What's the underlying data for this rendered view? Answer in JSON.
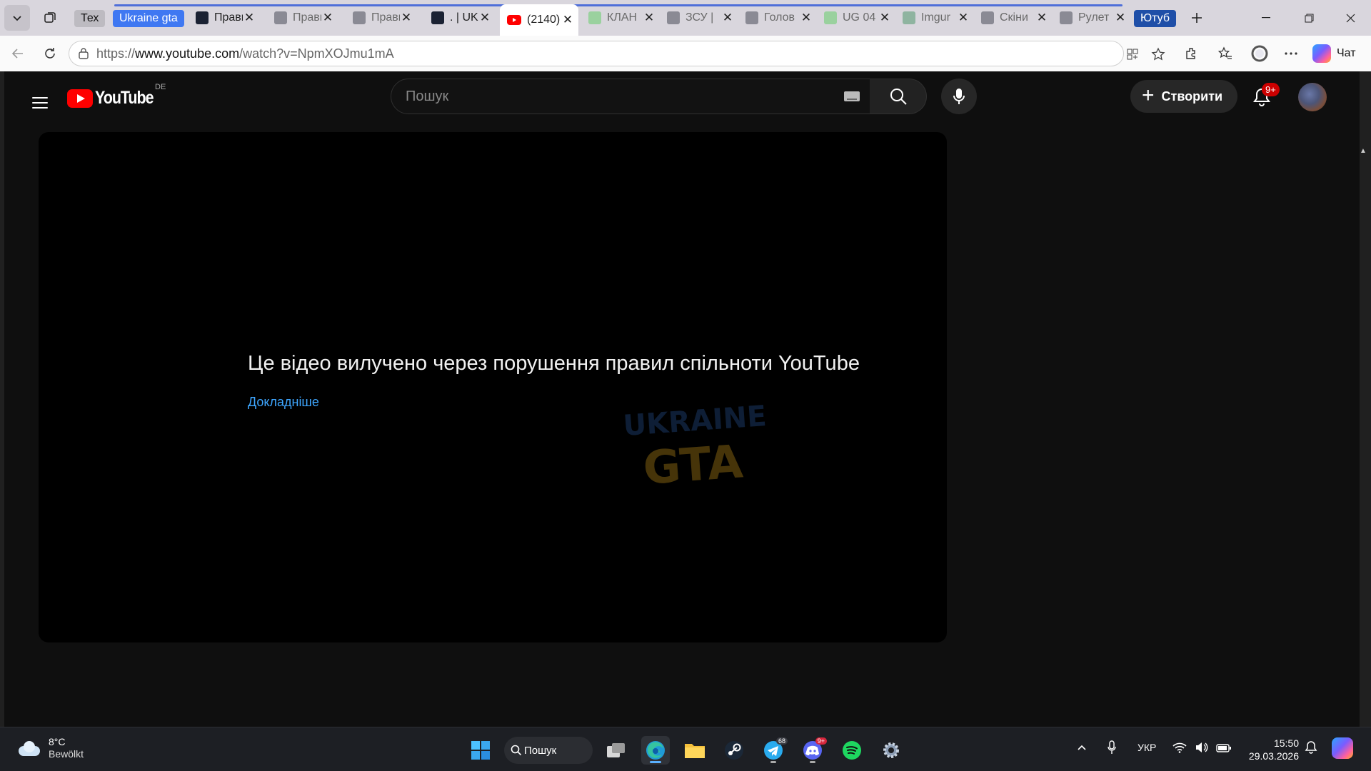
{
  "browser": {
    "tab_groups": [
      {
        "label": "Тех",
        "color": "#bdbbc1"
      },
      {
        "label": "Ukraine gta",
        "color": "#3f78f2"
      },
      {
        "label": "Ютуб",
        "color": "#1f4fa8"
      }
    ],
    "tabs": [
      {
        "title": "Прави",
        "active": false
      },
      {
        "title": "Прави",
        "active": false
      },
      {
        "title": "Прави",
        "active": false
      },
      {
        "title": ". | UKR",
        "active": false
      },
      {
        "title": "(2140)",
        "active": true
      },
      {
        "title": "КЛАН",
        "active": false
      },
      {
        "title": "ЗСУ |",
        "active": false
      },
      {
        "title": "Голов",
        "active": false
      },
      {
        "title": "UG 04",
        "active": false
      },
      {
        "title": "Imgur",
        "active": false
      },
      {
        "title": "Скіни",
        "active": false
      },
      {
        "title": "Рулет",
        "active": false
      }
    ],
    "url_prefix": "https://",
    "url_host": "www.youtube.com",
    "url_path": "/watch?v=NpmXOJmu1mA",
    "chat_label": "Чат"
  },
  "youtube": {
    "logo_text": "YouTube",
    "region": "DE",
    "search_placeholder": "Пошук",
    "create_label": "Створити",
    "notification_count": "9+",
    "error_message": "Це відео вилучено через порушення правил спільноти YouTube",
    "learn_more": "Докладніше",
    "watermark_line1": "UKRAINE",
    "watermark_line2": "GTA"
  },
  "taskbar": {
    "temperature": "8°C",
    "weather_condition": "Bewölkt",
    "search_label": "Пошук",
    "telegram_count": "68",
    "discord_count": "9+",
    "language": "УКР",
    "time": "15:50",
    "date": "29.03.2026"
  },
  "colors": {
    "yt_background": "#0f0f0f",
    "yt_red": "#ff0000",
    "link_blue": "#3ea6ff"
  }
}
